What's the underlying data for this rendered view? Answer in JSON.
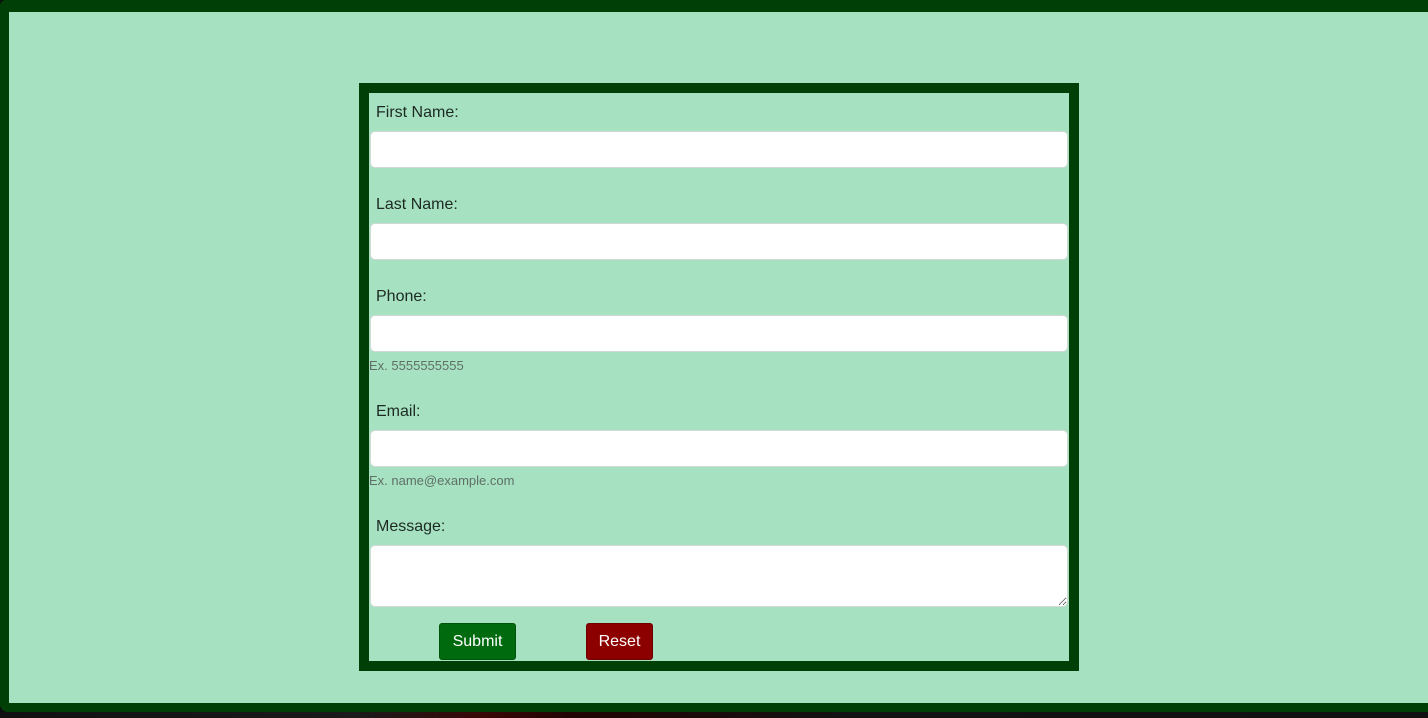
{
  "form": {
    "first_name": {
      "label": "First Name:",
      "value": ""
    },
    "last_name": {
      "label": "Last Name:",
      "value": ""
    },
    "phone": {
      "label": "Phone:",
      "value": "",
      "help": "Ex. 5555555555"
    },
    "email": {
      "label": "Email:",
      "value": "",
      "help": "Ex. name@example.com"
    },
    "message": {
      "label": "Message:",
      "value": ""
    },
    "submit_label": "Submit",
    "reset_label": "Reset"
  },
  "colors": {
    "background": "#a6e2c1",
    "frame": "#003f06",
    "submit": "#006b0e",
    "reset": "#8c0000"
  }
}
